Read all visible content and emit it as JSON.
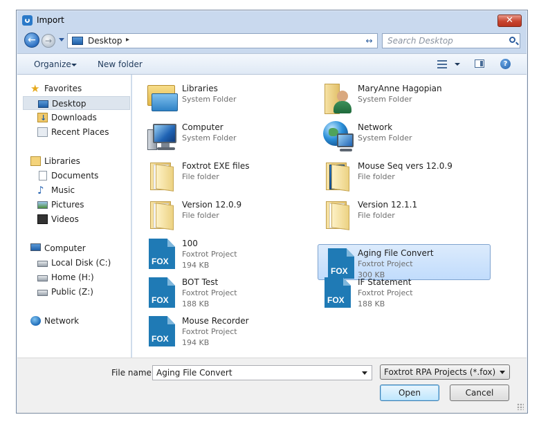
{
  "window": {
    "title": "Import",
    "close_label": "✕",
    "title_icon": "app-icon"
  },
  "nav": {
    "back_label": "←",
    "forward_label": "→",
    "address": "Desktop",
    "address_chevron": "▸",
    "refresh_label": "↔",
    "search_placeholder": "Search Desktop"
  },
  "toolbar": {
    "organize": "Organize",
    "new_folder": "New folder",
    "help_label": "?"
  },
  "sidebar": {
    "favorites": {
      "label": "Favorites",
      "icon": "star-icon"
    },
    "favorites_items": [
      {
        "label": "Desktop",
        "icon": "desktop-icon",
        "selected": true
      },
      {
        "label": "Downloads",
        "icon": "downloads-icon"
      },
      {
        "label": "Recent Places",
        "icon": "recent-places-icon"
      }
    ],
    "libraries": {
      "label": "Libraries",
      "icon": "libraries-icon"
    },
    "libraries_items": [
      {
        "label": "Documents",
        "icon": "documents-icon"
      },
      {
        "label": "Music",
        "icon": "music-icon"
      },
      {
        "label": "Pictures",
        "icon": "pictures-icon"
      },
      {
        "label": "Videos",
        "icon": "videos-icon"
      }
    ],
    "computer": {
      "label": "Computer",
      "icon": "computer-icon"
    },
    "computer_items": [
      {
        "label": "Local Disk (C:)",
        "icon": "disk-icon"
      },
      {
        "label": "Home (H:)",
        "icon": "network-drive-icon"
      },
      {
        "label": "Public (Z:)",
        "icon": "network-drive-icon"
      }
    ],
    "network": {
      "label": "Network",
      "icon": "network-icon"
    }
  },
  "files": [
    {
      "name": "Libraries",
      "type": "System Folder",
      "icon": "libraries-icon"
    },
    {
      "name": "MaryAnne Hagopian",
      "type": "System Folder",
      "icon": "user-folder-icon"
    },
    {
      "name": "Computer",
      "type": "System Folder",
      "icon": "computer-icon"
    },
    {
      "name": "Network",
      "type": "System Folder",
      "icon": "network-icon"
    },
    {
      "name": "Foxtrot EXE files",
      "type": "File folder",
      "icon": "folder-icon"
    },
    {
      "name": "Mouse Seq vers 12.0.9",
      "type": "File folder",
      "icon": "folder-icon"
    },
    {
      "name": "Version 12.0.9",
      "type": "File folder",
      "icon": "folder-icon"
    },
    {
      "name": "Version 12.1.1",
      "type": "File folder",
      "icon": "folder-icon"
    },
    {
      "name": "100",
      "type": "Foxtrot Project",
      "size": "194 KB",
      "icon": "fox-project-icon",
      "icon_text": "FOX"
    },
    {
      "name": "Aging File Convert",
      "type": "Foxtrot Project",
      "size": "300 KB",
      "icon": "fox-project-icon",
      "icon_text": "FOX",
      "selected": true
    },
    {
      "name": "BOT Test",
      "type": "Foxtrot Project",
      "size": "188 KB",
      "icon": "fox-project-icon",
      "icon_text": "FOX"
    },
    {
      "name": "IF Statement",
      "type": "Foxtrot Project",
      "size": "188 KB",
      "icon": "fox-project-icon",
      "icon_text": "FOX"
    },
    {
      "name": "Mouse Recorder",
      "type": "Foxtrot Project",
      "size": "194 KB",
      "icon": "fox-project-icon",
      "icon_text": "FOX"
    }
  ],
  "bottom": {
    "filename_label": "File name:",
    "filename_value": "Aging File Convert",
    "filetype_value": "Foxtrot RPA Projects (*.fox)",
    "open_label": "Open",
    "cancel_label": "Cancel"
  },
  "colors": {
    "frame": "#c9d9ee",
    "selection": "#c1dcfc",
    "close_button": "#c8452f",
    "fox_icon": "#1f7ab5"
  }
}
